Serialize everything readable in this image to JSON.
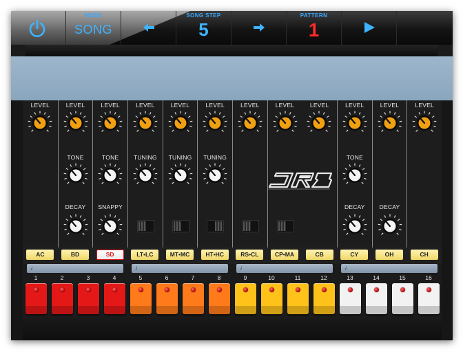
{
  "topbar": {
    "power_icon": "power-icon",
    "mode": {
      "label": "MODE",
      "value": "SONG"
    },
    "step_back_icon": "arrow-left-icon",
    "song_step": {
      "label": "SONG STEP",
      "value": "5"
    },
    "step_forward_icon": "arrow-right-icon",
    "pattern": {
      "label": "PATTERN",
      "value": "1"
    },
    "play_icon": "play-icon"
  },
  "channels": [
    {
      "id": "ac",
      "level": "LEVEL",
      "mid": "",
      "low": ""
    },
    {
      "id": "bd",
      "level": "LEVEL",
      "mid": "TONE",
      "low": "DECAY"
    },
    {
      "id": "sd",
      "level": "LEVEL",
      "mid": "TONE",
      "low": "SNAPPY"
    },
    {
      "id": "lt",
      "level": "LEVEL",
      "mid": "TUNING",
      "low": ""
    },
    {
      "id": "mt",
      "level": "LEVEL",
      "mid": "TUNING",
      "low": ""
    },
    {
      "id": "ht",
      "level": "LEVEL",
      "mid": "TUNING",
      "low": ""
    },
    {
      "id": "rs",
      "level": "LEVEL",
      "mid": "",
      "low": ""
    },
    {
      "id": "cp",
      "level": "LEVEL",
      "mid": "",
      "low": ""
    },
    {
      "id": "cb",
      "level": "LEVEL",
      "mid": "",
      "low": ""
    },
    {
      "id": "cy",
      "level": "LEVEL",
      "mid": "TONE",
      "low": "DECAY"
    },
    {
      "id": "oh",
      "level": "LEVEL",
      "mid": "",
      "low": "DECAY"
    },
    {
      "id": "ch",
      "level": "LEVEL",
      "mid": "",
      "low": ""
    }
  ],
  "logo_text": "DR8",
  "instruments": [
    {
      "label": "AC",
      "active": false
    },
    {
      "label": "BD",
      "active": false
    },
    {
      "label": "SD",
      "active": true
    },
    {
      "label": "LT•LC",
      "active": false
    },
    {
      "label": "MT•MC",
      "active": false
    },
    {
      "label": "HT•HC",
      "active": false
    },
    {
      "label": "RS•CL",
      "active": false
    },
    {
      "label": "CP•MA",
      "active": false
    },
    {
      "label": "CB",
      "active": false
    },
    {
      "label": "CY",
      "active": false
    },
    {
      "label": "OH",
      "active": false
    },
    {
      "label": "CH",
      "active": false
    }
  ],
  "note_icon": "♩",
  "step_numbers": [
    "1",
    "2",
    "3",
    "4",
    "5",
    "6",
    "7",
    "8",
    "9",
    "10",
    "11",
    "12",
    "13",
    "14",
    "15",
    "16"
  ],
  "colors": {
    "accent": "#3fb3ff",
    "pattern": "#ff2a2a",
    "knob_level": "#f0a010",
    "pad_groups": [
      "#e51818",
      "#ff7a1a",
      "#ffc21a",
      "#f2f2f2"
    ]
  }
}
